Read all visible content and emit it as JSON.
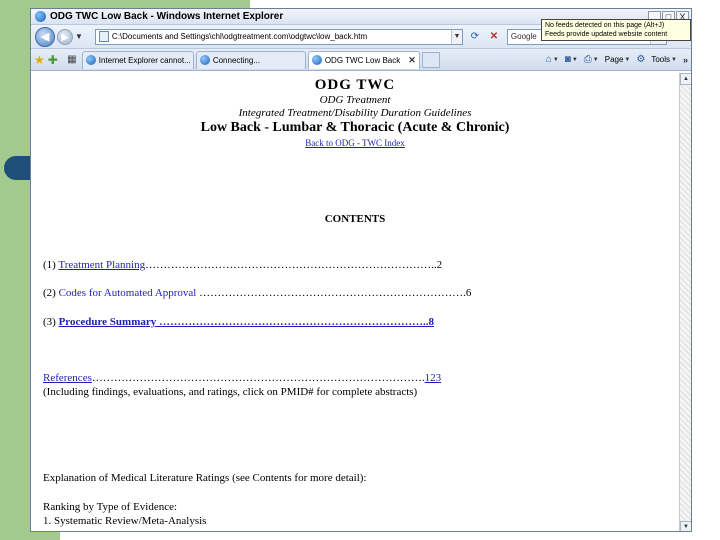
{
  "window": {
    "title": "ODG TWC Low Back - Windows Internet Explorer",
    "controls": {
      "minimize": "_",
      "maximize": "□",
      "close": "X"
    }
  },
  "address": {
    "url": "C:\\Documents and Settings\\chl\\odgtreatment.com\\odgtwc\\low_back.htm",
    "search_placeholder": "Google"
  },
  "tabs": [
    {
      "label": "Internet Explorer cannot..."
    },
    {
      "label": "Connecting..."
    },
    {
      "label": "ODG TWC Low Back",
      "active": true
    }
  ],
  "commands": {
    "page": "Page",
    "tools": "Tools"
  },
  "infobar": {
    "line1": "No feeds detected on this page (Alt+J)",
    "line2": "Feeds provide updated website content"
  },
  "doc": {
    "title": "ODG  TWC",
    "subtitle": "ODG Treatment",
    "line3": "Integrated Treatment/Disability Duration Guidelines",
    "line4": "Low Back - Lumbar & Thoracic (Acute & Chronic)",
    "back_link": "Back to ODG - TWC Index",
    "contents": "CONTENTS",
    "toc": [
      {
        "prefix": "(1) ",
        "label": "Treatment Planning",
        "dots": "……………………………………………………………………..",
        "page": "2"
      },
      {
        "prefix": "(2) ",
        "label": "Codes for Automated Approval",
        "dots": "  ……………………………………………………………….",
        "page": "6"
      },
      {
        "prefix": "(3) ",
        "label": "Procedure Summary",
        "dots": "  ………………………………………………………………..",
        "page": "8"
      }
    ],
    "references": {
      "label": "References",
      "dots": "……………………………………………………………………………….",
      "page": "123"
    },
    "references_note": "(Including findings, evaluations, and ratings, click on PMID# for complete abstracts)",
    "explanation": "Explanation of Medical Literature Ratings (see Contents for more detail):",
    "ranking": "Ranking by Type of Evidence:",
    "ranking_1": "1. Systematic Review/Meta-Analysis"
  }
}
